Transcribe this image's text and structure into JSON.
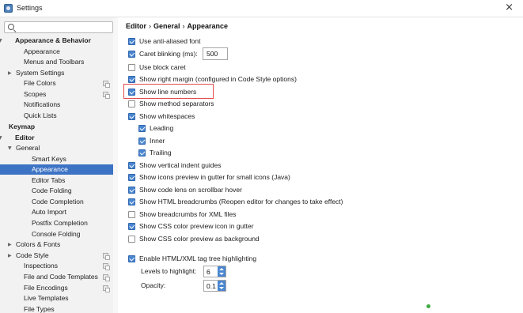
{
  "window": {
    "title": "Settings",
    "close_glyph": "×"
  },
  "search": {
    "placeholder": "",
    "value": ""
  },
  "sidebar": {
    "items": [
      {
        "label": "Appearance & Behavior",
        "bold": true,
        "caret": "▼"
      },
      {
        "label": "Appearance"
      },
      {
        "label": "Menus and Toolbars"
      },
      {
        "label": "System Settings",
        "caret": "▶"
      },
      {
        "label": "File Colors",
        "scope": true
      },
      {
        "label": "Scopes",
        "scope": true
      },
      {
        "label": "Notifications"
      },
      {
        "label": "Quick Lists"
      },
      {
        "label": "Keymap",
        "bold": true
      },
      {
        "label": "Editor",
        "bold": true,
        "caret": "▼"
      },
      {
        "label": "General",
        "caret": "▼"
      },
      {
        "label": "Smart Keys"
      },
      {
        "label": "Appearance",
        "selected": true
      },
      {
        "label": "Editor Tabs"
      },
      {
        "label": "Code Folding"
      },
      {
        "label": "Code Completion"
      },
      {
        "label": "Auto Import"
      },
      {
        "label": "Postfix Completion"
      },
      {
        "label": "Console Folding"
      },
      {
        "label": "Colors & Fonts",
        "caret": "▶"
      },
      {
        "label": "Code Style",
        "caret": "▶",
        "scope": true
      },
      {
        "label": "Inspections",
        "scope": true
      },
      {
        "label": "File and Code Templates",
        "scope": true
      },
      {
        "label": "File Encodings",
        "scope": true
      },
      {
        "label": "Live Templates"
      },
      {
        "label": "File Types"
      }
    ]
  },
  "breadcrumb": {
    "part1": "Editor",
    "part2": "General",
    "part3": "Appearance",
    "separator": "›"
  },
  "options": [
    {
      "label": "Use anti-aliased font",
      "checked": true
    },
    {
      "label": "Caret blinking (ms):",
      "checked": true
    },
    {
      "label": "Use block caret",
      "checked": false
    },
    {
      "label": "Show right margin (configured in Code Style options)",
      "checked": true
    },
    {
      "label": "Show line numbers",
      "checked": true
    },
    {
      "label": "Show method separators",
      "checked": false
    },
    {
      "label": "Show whitespaces",
      "checked": true
    },
    {
      "label": "Leading",
      "checked": true
    },
    {
      "label": "Inner",
      "checked": true
    },
    {
      "label": "Trailing",
      "checked": true
    },
    {
      "label": "Show vertical indent guides",
      "checked": true
    },
    {
      "label": "Show icons preview in gutter for small icons (Java)",
      "checked": true
    },
    {
      "label": "Show code lens on scrollbar hover",
      "checked": true
    },
    {
      "label": "Show HTML breadcrumbs (Reopen editor for changes to take effect)",
      "checked": true
    },
    {
      "label": "Show breadcrumbs for XML files",
      "checked": false
    },
    {
      "label": "Show CSS color preview icon in gutter",
      "checked": true
    },
    {
      "label": "Show CSS color preview as background",
      "checked": false
    },
    {
      "label": "Enable HTML/XML tag tree highlighting",
      "checked": true
    }
  ],
  "caret_blink_ms": "500",
  "levels": {
    "label": "Levels to highlight:",
    "value": "6"
  },
  "opacity": {
    "label": "Opacity:",
    "value": "0.1"
  },
  "colors": {
    "accent": "#4a86d0",
    "selection": "#3d73c4",
    "highlight_border": "#e34a4a"
  }
}
